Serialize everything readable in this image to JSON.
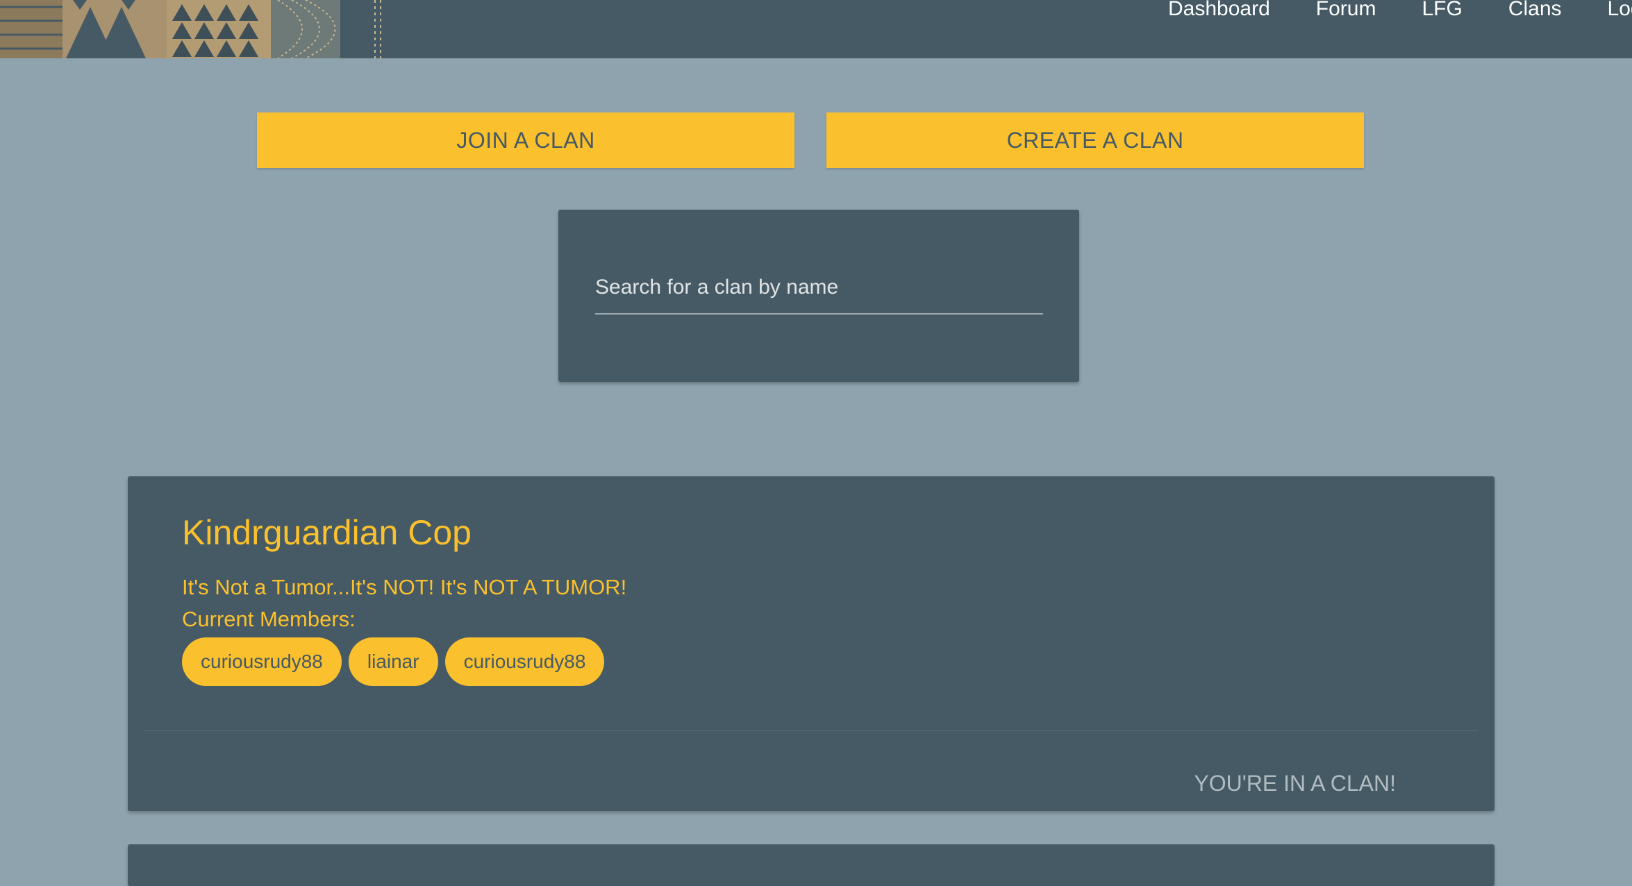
{
  "nav": {
    "links": [
      "Dashboard",
      "Forum",
      "LFG",
      "Clans",
      "Logout"
    ]
  },
  "actions": {
    "join_label": "JOIN A CLAN",
    "create_label": "CREATE A CLAN"
  },
  "search": {
    "placeholder": "Search for a clan by name",
    "value": ""
  },
  "clan": {
    "name": "Kindrguardian Cop",
    "motto": "It's Not a Tumor...It's NOT! It's NOT A TUMOR!",
    "members_label": "Current Members:",
    "members": [
      "curiousrudy88",
      "liainar",
      "curiousrudy88"
    ],
    "status": "YOU'RE IN A CLAN!"
  },
  "colors": {
    "navbar": "#455a64",
    "background": "#8fa3ae",
    "accent": "#fbc02d",
    "card": "#455a64"
  }
}
